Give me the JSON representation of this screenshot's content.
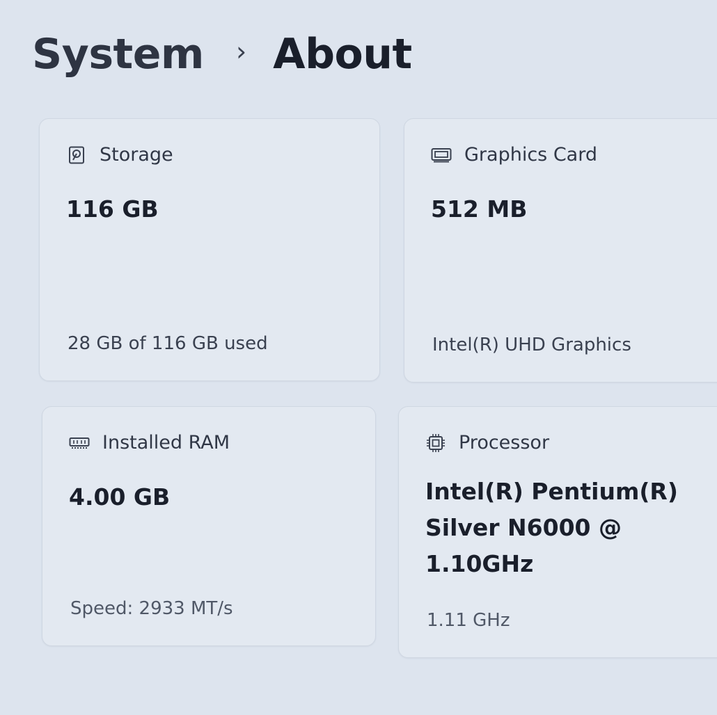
{
  "breadcrumb": {
    "parent": "System",
    "separator": "›",
    "current": "About"
  },
  "cards": {
    "storage": {
      "icon": "hard-drive-icon",
      "title": "Storage",
      "value": "116 GB",
      "subtitle": "28 GB of 116 GB used"
    },
    "graphics": {
      "icon": "graphics-card-icon",
      "title": "Graphics Card",
      "value": "512 MB",
      "subtitle": "Intel(R) UHD Graphics"
    },
    "ram": {
      "icon": "memory-module-icon",
      "title": "Installed RAM",
      "value": "4.00 GB",
      "subtitle": "Speed: 2933 MT/s"
    },
    "processor": {
      "icon": "processor-chip-icon",
      "title": "Processor",
      "value": "Intel(R) Pentium(R) Silver N6000 @ 1.10GHz",
      "subtitle": "1.11 GHz"
    }
  }
}
